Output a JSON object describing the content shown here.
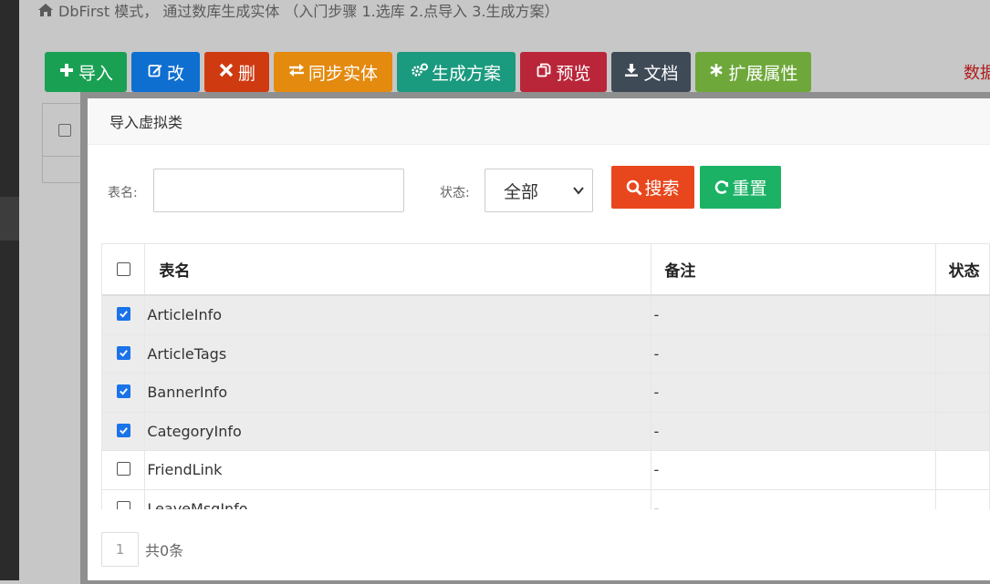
{
  "background": {
    "title": "DbFirst 模式， 通过数库生成实体 （入门步骤 1.选库 2.点导入 3.生成方案）",
    "right_text": "数据",
    "toolbar": [
      {
        "label": "导入",
        "icon": "plus-icon",
        "color": "#1aa053"
      },
      {
        "label": "改",
        "icon": "edit-icon",
        "color": "#0f6fd1"
      },
      {
        "label": "删",
        "icon": "close-icon",
        "color": "#cf3a11"
      },
      {
        "label": "同步实体",
        "icon": "exchange-icon",
        "color": "#e48a0f"
      },
      {
        "label": "生成方案",
        "icon": "gears-icon",
        "color": "#1a9a7e"
      },
      {
        "label": "预览",
        "icon": "copy-icon",
        "color": "#b9263a"
      },
      {
        "label": "文档",
        "icon": "download-icon",
        "color": "#3f4a57"
      },
      {
        "label": "扩展属性",
        "icon": "asterisk-icon",
        "color": "#6ea83b"
      }
    ]
  },
  "modal": {
    "title": "导入虚拟类",
    "search": {
      "name_label": "表名:",
      "name_value": "",
      "name_placeholder": "",
      "status_label": "状态:",
      "status_value": "全部",
      "search_button": "搜索",
      "reset_button": "重置",
      "search_color": "#e8461c",
      "reset_color": "#1cb266"
    },
    "table": {
      "columns": [
        "表名",
        "备注",
        "状态"
      ],
      "rows": [
        {
          "name": "ArticleInfo",
          "note": "-",
          "checked": true
        },
        {
          "name": "ArticleTags",
          "note": "-",
          "checked": true
        },
        {
          "name": "BannerInfo",
          "note": "-",
          "checked": true
        },
        {
          "name": "CategoryInfo",
          "note": "-",
          "checked": true
        },
        {
          "name": "FriendLink",
          "note": "-",
          "checked": false
        },
        {
          "name": "LeaveMsgInfo",
          "note": "-",
          "checked": false
        }
      ]
    },
    "pager": {
      "page": "1",
      "total": "共0条"
    }
  }
}
